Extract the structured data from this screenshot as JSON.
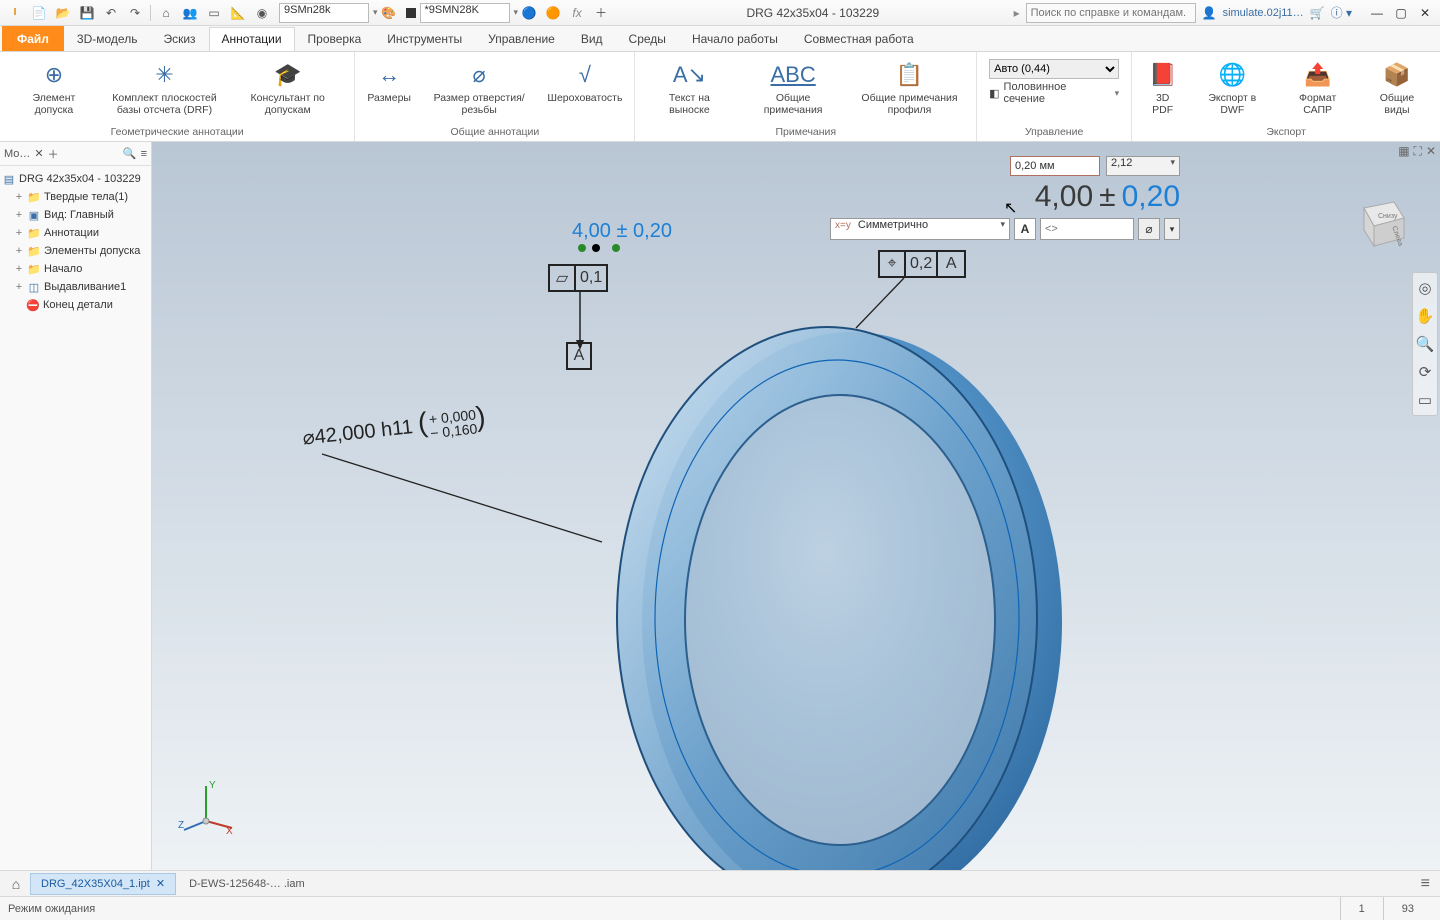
{
  "title": "DRG 42x35x04  -  103229",
  "qat_material1": "9SMn28k",
  "qat_material2": "*9SMN28K",
  "search_placeholder": "Поиск по справке и командам.",
  "user": "simulate.02j11…",
  "tabs": {
    "file": "Файл",
    "model": "3D-модель",
    "sketch": "Эскиз",
    "annotate": "Аннотации",
    "inspect": "Проверка",
    "tools": "Инструменты",
    "manage": "Управление",
    "view": "Вид",
    "env": "Среды",
    "start": "Начало работы",
    "collab": "Совместная работа"
  },
  "ribbon": {
    "geom": {
      "title": "Геометрические аннотации",
      "tolfeat": "Элемент допуска",
      "drf": "Комплект плоскостей базы отсчета (DRF)",
      "advisor": "Консультант по допускам"
    },
    "general": {
      "title": "Общие аннотации",
      "dim": "Размеры",
      "holethread": "Размер отверстия/резьбы",
      "surface": "Шероховатость"
    },
    "notes": {
      "title": "Примечания",
      "leader": "Текст на выноске",
      "gennotes": "Общие примечания",
      "profnotes": "Общие примечания профиля"
    },
    "manage": {
      "title": "Управление",
      "auto": "Авто (0,44)",
      "half": "Половинное сечение"
    },
    "export": {
      "title": "Экспорт",
      "pdf": "3D PDF",
      "dwf": "Экспорт в DWF",
      "cad": "Формат САПР",
      "views": "Общие виды"
    }
  },
  "browser": {
    "title": "Мо…",
    "root": "DRG 42x35x04  -  103229",
    "solids": "Твердые тела(1)",
    "view": "Вид: Главный",
    "anno": "Аннотации",
    "toleranced": "Элементы допуска",
    "origin": "Начало",
    "extrude": "Выдавливание1",
    "end": "Конец детали"
  },
  "toledit": {
    "val": "0,20 мм",
    "prec": "2,12",
    "big_nom": "4,00",
    "big_pm": "±",
    "big_tol": "0,20",
    "symlabel": "x=y",
    "sym": "Симметрично",
    "A": "A",
    "ovr": "<>"
  },
  "callouts": {
    "topdim": "4,00 ± 0,20",
    "flat_val": "0,1",
    "datumA": "A",
    "pos_val": "0,2",
    "pos_datum": "A",
    "diadim_main": "⌀42,000 h11",
    "diadim_upper": "+ 0,000",
    "diadim_lower": "− 0,160"
  },
  "viewcube": {
    "front": "Снизу",
    "right": "Слева"
  },
  "doctabs": {
    "active": "DRG_42X35X04_1.ipt",
    "other": "D-EWS-125648-… .iam"
  },
  "status": {
    "mode": "Режим ожидания",
    "n1": "1",
    "n2": "93"
  }
}
